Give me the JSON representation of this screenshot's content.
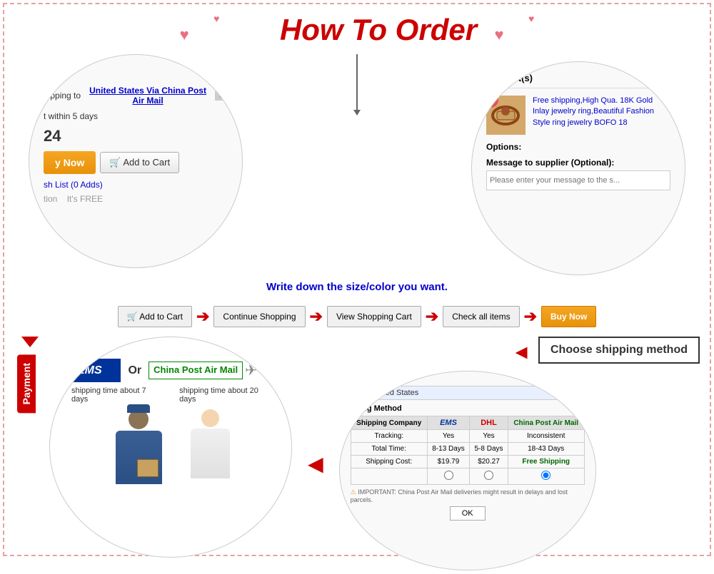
{
  "page": {
    "title": "How To Order",
    "border_color": "#e8a0a0"
  },
  "title": {
    "text": "How To Order",
    "hearts_top": [
      "♥",
      "♥",
      "♥",
      "♥",
      "♥"
    ]
  },
  "top_left_circle": {
    "shipping_label": "air",
    "shipping_to": "hipping to",
    "shipping_link": "United States Via China Post Air Mail",
    "days_label": "t within 5 days",
    "price": "24",
    "buy_now": "y Now",
    "add_to_cart": "Add to Cart",
    "wish_list": "sh List (0 Adds)",
    "protection_label": "tion",
    "protection_value": "It's FREE"
  },
  "top_right_circle": {
    "header": "Product(s)",
    "product_text": "Free shipping,High Qua. 18K Gold Inlay jewelry ring,Beautiful Fashion Style ring jewelry BOFO 18",
    "options_label": "Options:",
    "message_label": "Message to supplier (Optional):",
    "message_placeholder": "Please enter your message to the s..."
  },
  "write_down_text": "Write down the size/color you want.",
  "flow": {
    "steps": [
      {
        "label": "Add to Cart",
        "icon": "cart"
      },
      {
        "label": "Continue Shopping"
      },
      {
        "label": "View Shopping Cart"
      },
      {
        "label": "Check all items"
      },
      {
        "label": "Buy Now",
        "highlight": true
      }
    ],
    "arrows": [
      "→",
      "→",
      "→",
      "→"
    ]
  },
  "bottom": {
    "payment_tab": "Payment",
    "choose_shipping_label": "Choose shipping method",
    "left_circle": {
      "ems_label": "EMS",
      "or_text": "Or",
      "china_post_label": "China Post Air Mail",
      "ems_time": "shipping time about 7 days",
      "china_post_time": "shipping time about 20 days"
    },
    "shipping_table": {
      "location": "United States",
      "method_label": "pping Method",
      "company_label": "pping Company:",
      "tracking_label": "Tracking:",
      "total_time_label": "Total Time:",
      "shipping_cost_label": "Shipping Cost:",
      "columns": [
        "EMS",
        "DHL",
        "China Post Air Mail"
      ],
      "tracking_values": [
        "Yes",
        "Yes",
        "Inconsistent"
      ],
      "total_time_values": [
        "8-13 Days",
        "5-8 Days",
        "18-43 Days"
      ],
      "shipping_cost_values": [
        "$19.79",
        "$20.27",
        "Free Shipping"
      ],
      "important_note": "IMPORTANT: China Post Air Mail deliveries might result in delays and lost parcels.",
      "ok_btn": "OK"
    }
  },
  "icons": {
    "cart_icon": "🛒",
    "heart_icon": "♥",
    "arrow_right": "➔",
    "arrow_down": "▼",
    "arrow_left": "◄"
  }
}
